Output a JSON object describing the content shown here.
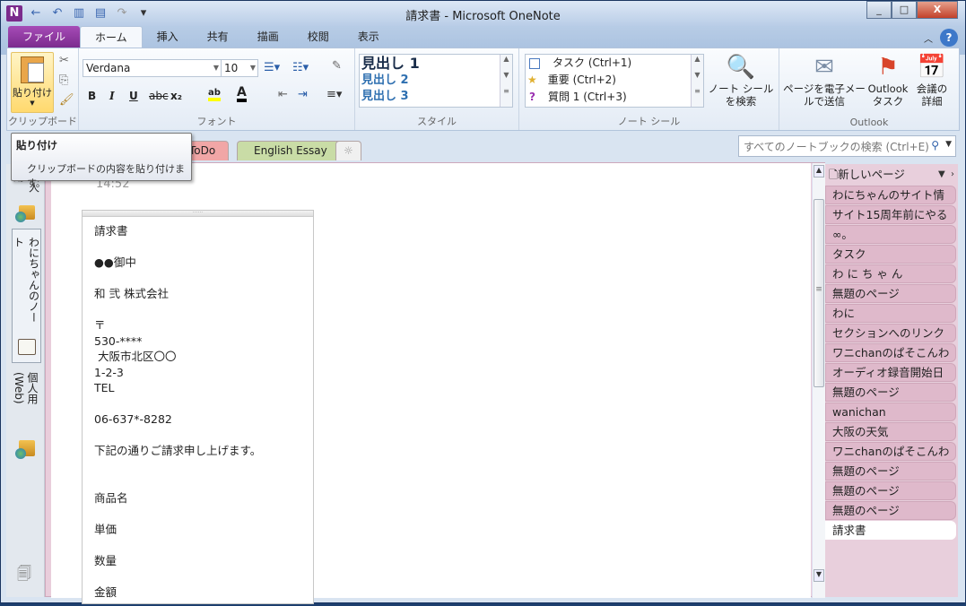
{
  "window": {
    "title": "請求書 - Microsoft OneNote",
    "minimize": "_",
    "maximize": "□",
    "close": "X"
  },
  "qat": [
    "N",
    "←",
    "↶",
    "▥",
    "▤",
    "↷",
    "▾"
  ],
  "ribbon_tabs": [
    "ファイル",
    "ホーム",
    "挿入",
    "共有",
    "描画",
    "校閲",
    "表示"
  ],
  "clipboard": {
    "paste": "貼り付け",
    "group": "クリップボード"
  },
  "font": {
    "name": "Verdana",
    "size": "10",
    "bold": "B",
    "italic": "I",
    "underline": "U",
    "strike": "abc",
    "subscript": "x₂",
    "highlight": "ab",
    "font_color": "A",
    "group": "フォント",
    "highlight_color": "#ffff00",
    "font_color_value": "#000000"
  },
  "styles": {
    "items": [
      "見出し 1",
      "見出し 2",
      "見出し 3"
    ],
    "group": "スタイル"
  },
  "tags": {
    "items": [
      "タスク (Ctrl+1)",
      "重要 (Ctrl+2)",
      "質問 1 (Ctrl+3)"
    ],
    "find": "ノート シールを検索",
    "group": "ノート シール"
  },
  "outlook": {
    "email": "ページを電子メールで送信",
    "tasks": "Outlook タスク",
    "meeting": "会議の詳細",
    "group": "Outlook"
  },
  "tooltip": {
    "title": "貼り付け",
    "desc": "クリップボードの内容を貼り付けます。"
  },
  "sections": [
    {
      "label": "ToDo",
      "color": "#f1a6a6"
    },
    {
      "label": "English Essay",
      "color": "#c9dca6"
    }
  ],
  "new_section": "☼",
  "search": {
    "placeholder": "すべてのノートブックの検索 (Ctrl+E)"
  },
  "notebooks": [
    "個人用",
    "わにちゃんのノート",
    "個人用 (Web)"
  ],
  "page": {
    "time": "14:52",
    "lines": [
      "請求書",
      "",
      "●●御中",
      "",
      "和 弐 株式会社",
      "",
      "〒",
      "530-****",
      " 大阪市北区〇〇",
      "1-2-3",
      "TEL",
      "",
      "06-637*-8282",
      "",
      "下記の通りご請求申し上げます。",
      "",
      "",
      "商品名",
      "",
      "単価",
      "",
      "数量",
      "",
      "金額"
    ]
  },
  "pagelist": {
    "new_page": "新しいページ",
    "pages": [
      "わにちゃんのサイト情",
      "サイト15周年前にやる",
      "∞。",
      "タスク",
      "わ に ち ゃ ん",
      "無題のページ",
      "わに",
      "セクションへのリンク",
      "ワニchanのぱそこんわ",
      "オーディオ録音開始日",
      "無題のページ",
      "wanichan",
      "大阪の天気",
      "ワニchanのぱそこんわ",
      "無題のページ",
      "無題のページ",
      "無題のページ",
      "請求書"
    ],
    "selected": "請求書"
  }
}
